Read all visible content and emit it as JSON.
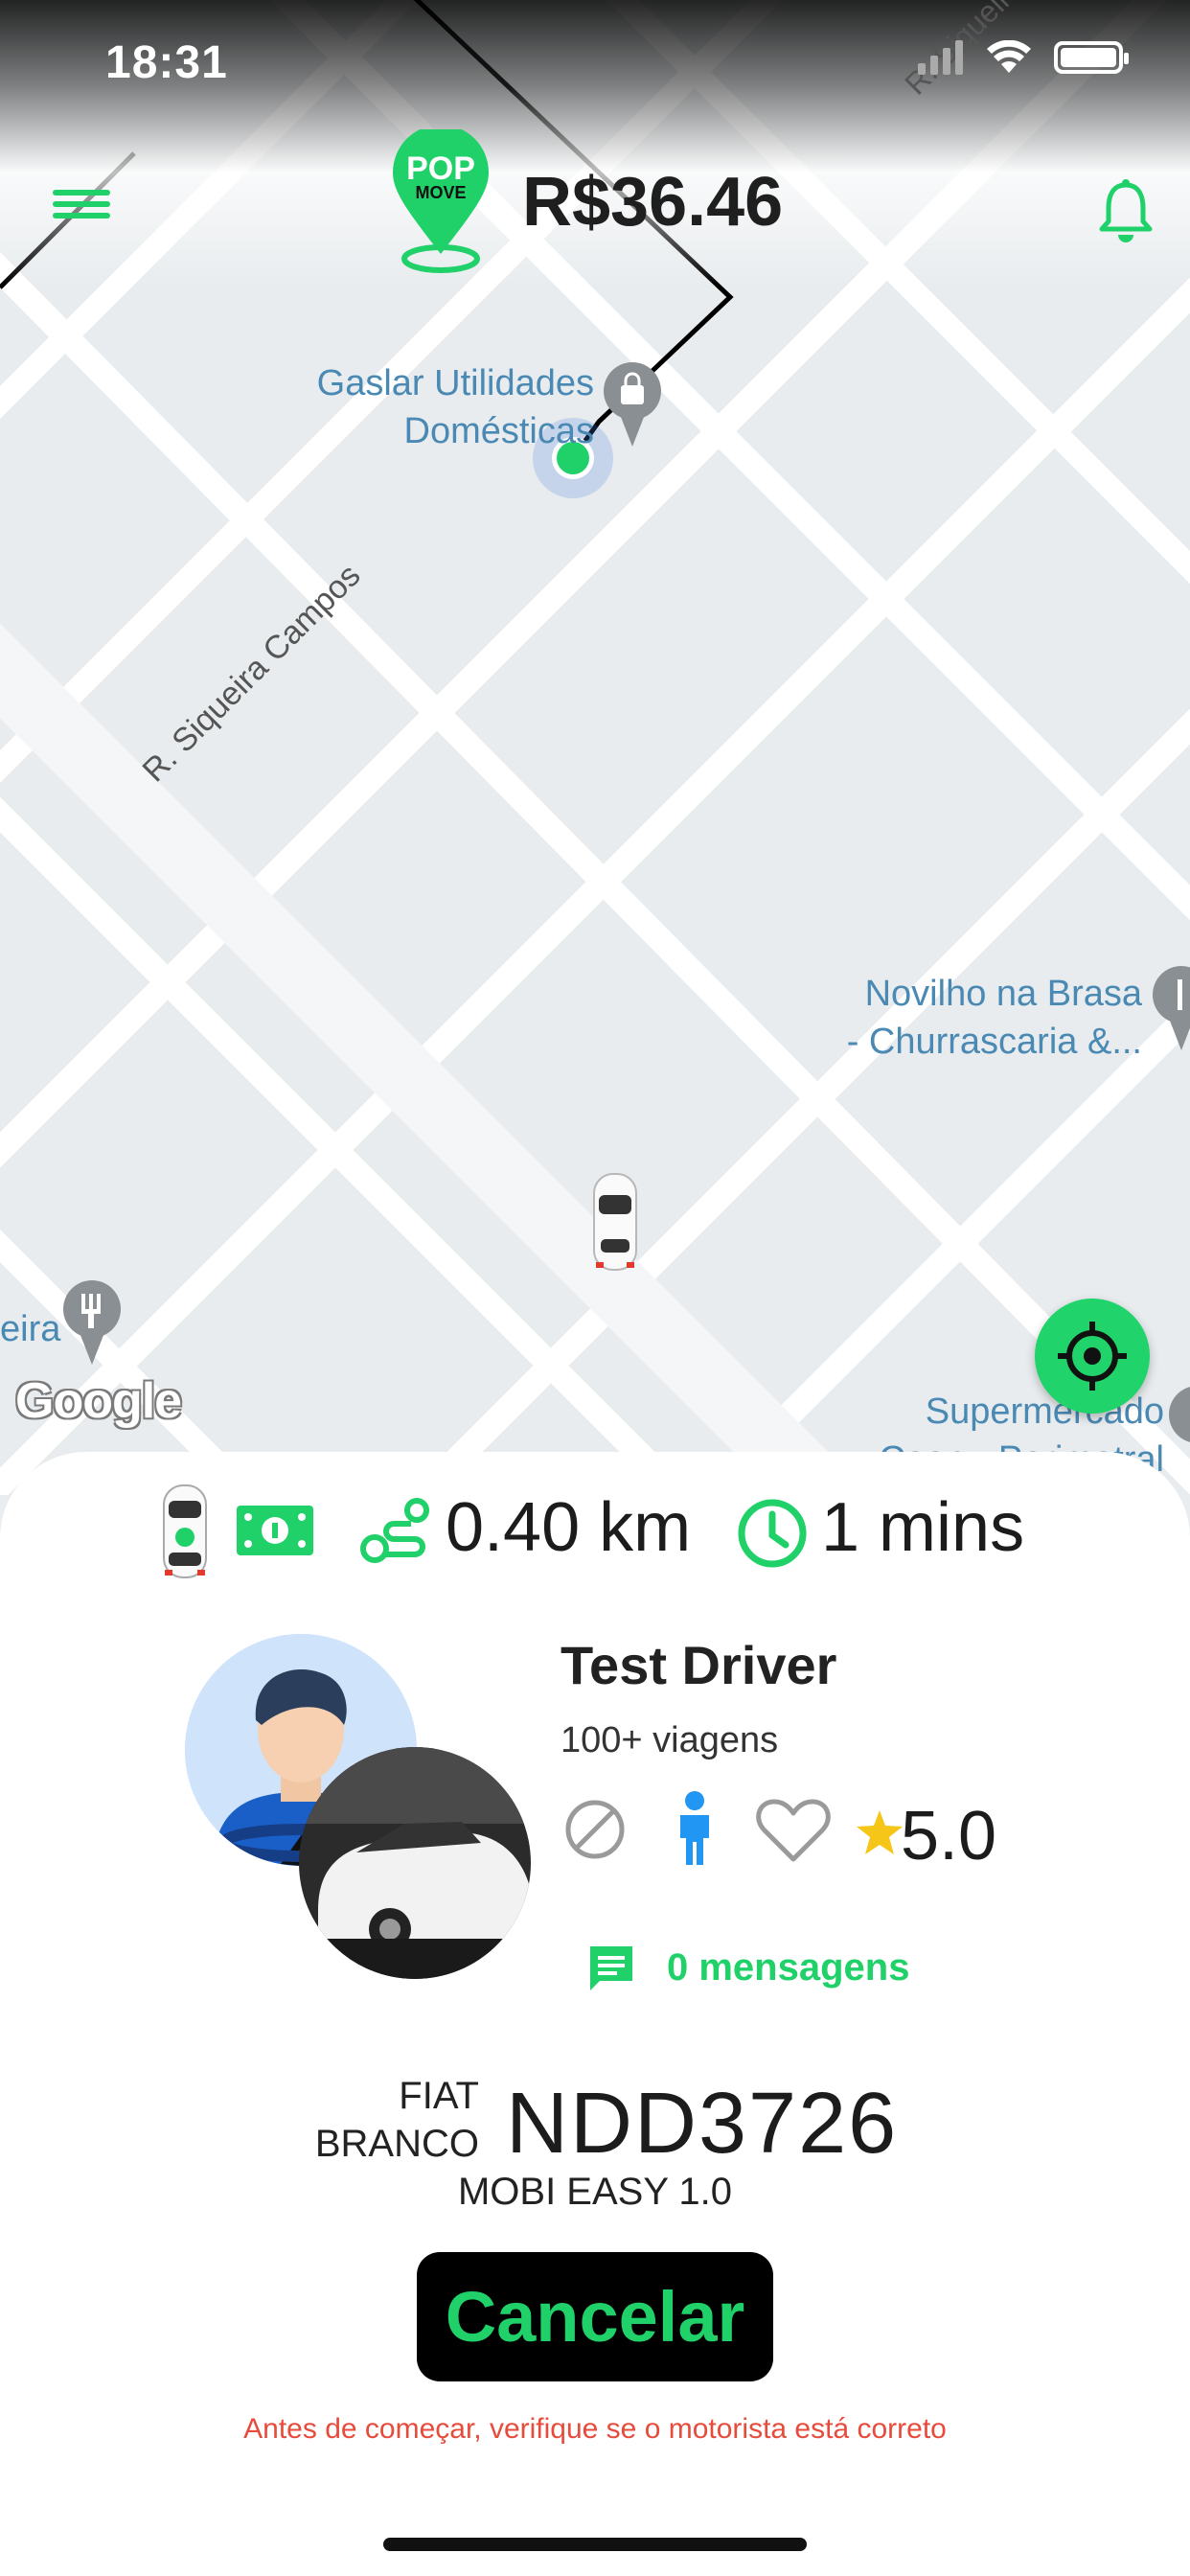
{
  "status_bar": {
    "time": "18:31"
  },
  "header": {
    "fare": "R$36.46",
    "logo_top": "POP",
    "logo_bottom": "MOVE"
  },
  "map": {
    "labels": {
      "store": [
        "Gaslar Utilidades",
        "Domésticas"
      ],
      "street": "R. Siqueira Campos",
      "street_top": "R. Siqueira",
      "restaurant": [
        "Novilho na Brasa",
        "- Churrascaria &..."
      ],
      "supermarket": [
        "Supermercado",
        "Coop - Perimetral"
      ],
      "partial": "eira"
    },
    "attribution": "Google"
  },
  "trip": {
    "distance": "0.40 km",
    "eta": "1 mins"
  },
  "driver": {
    "name": "Test Driver",
    "trips": "100+ viagens",
    "rating": "5.0",
    "messages": "0 mensagens"
  },
  "vehicle": {
    "make": "FIAT",
    "color": "BRANCO",
    "plate": "NDD3726",
    "model": "MOBI EASY 1.0"
  },
  "actions": {
    "cancel_label": "Cancelar"
  },
  "notice": "Antes de começar, verifique se o motorista está correto",
  "colors": {
    "accent": "#1fd168",
    "warning": "#e74b3c",
    "blue": "#2196f3",
    "star": "#f5c518"
  }
}
